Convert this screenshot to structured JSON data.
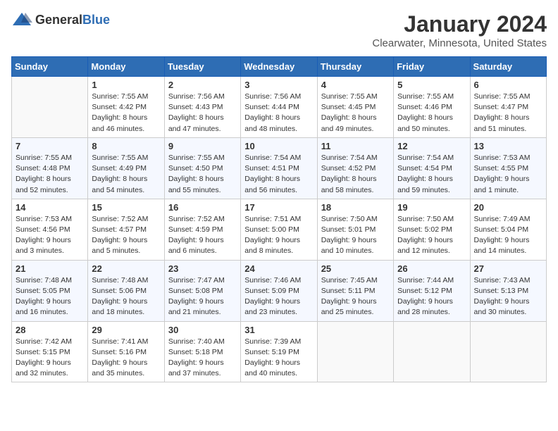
{
  "header": {
    "logo_general": "General",
    "logo_blue": "Blue",
    "month_title": "January 2024",
    "location": "Clearwater, Minnesota, United States"
  },
  "days_of_week": [
    "Sunday",
    "Monday",
    "Tuesday",
    "Wednesday",
    "Thursday",
    "Friday",
    "Saturday"
  ],
  "weeks": [
    [
      {
        "day": "",
        "sunrise": "",
        "sunset": "",
        "daylight": ""
      },
      {
        "day": "1",
        "sunrise": "Sunrise: 7:55 AM",
        "sunset": "Sunset: 4:42 PM",
        "daylight": "Daylight: 8 hours and 46 minutes."
      },
      {
        "day": "2",
        "sunrise": "Sunrise: 7:56 AM",
        "sunset": "Sunset: 4:43 PM",
        "daylight": "Daylight: 8 hours and 47 minutes."
      },
      {
        "day": "3",
        "sunrise": "Sunrise: 7:56 AM",
        "sunset": "Sunset: 4:44 PM",
        "daylight": "Daylight: 8 hours and 48 minutes."
      },
      {
        "day": "4",
        "sunrise": "Sunrise: 7:55 AM",
        "sunset": "Sunset: 4:45 PM",
        "daylight": "Daylight: 8 hours and 49 minutes."
      },
      {
        "day": "5",
        "sunrise": "Sunrise: 7:55 AM",
        "sunset": "Sunset: 4:46 PM",
        "daylight": "Daylight: 8 hours and 50 minutes."
      },
      {
        "day": "6",
        "sunrise": "Sunrise: 7:55 AM",
        "sunset": "Sunset: 4:47 PM",
        "daylight": "Daylight: 8 hours and 51 minutes."
      }
    ],
    [
      {
        "day": "7",
        "sunrise": "Sunrise: 7:55 AM",
        "sunset": "Sunset: 4:48 PM",
        "daylight": "Daylight: 8 hours and 52 minutes."
      },
      {
        "day": "8",
        "sunrise": "Sunrise: 7:55 AM",
        "sunset": "Sunset: 4:49 PM",
        "daylight": "Daylight: 8 hours and 54 minutes."
      },
      {
        "day": "9",
        "sunrise": "Sunrise: 7:55 AM",
        "sunset": "Sunset: 4:50 PM",
        "daylight": "Daylight: 8 hours and 55 minutes."
      },
      {
        "day": "10",
        "sunrise": "Sunrise: 7:54 AM",
        "sunset": "Sunset: 4:51 PM",
        "daylight": "Daylight: 8 hours and 56 minutes."
      },
      {
        "day": "11",
        "sunrise": "Sunrise: 7:54 AM",
        "sunset": "Sunset: 4:52 PM",
        "daylight": "Daylight: 8 hours and 58 minutes."
      },
      {
        "day": "12",
        "sunrise": "Sunrise: 7:54 AM",
        "sunset": "Sunset: 4:54 PM",
        "daylight": "Daylight: 8 hours and 59 minutes."
      },
      {
        "day": "13",
        "sunrise": "Sunrise: 7:53 AM",
        "sunset": "Sunset: 4:55 PM",
        "daylight": "Daylight: 9 hours and 1 minute."
      }
    ],
    [
      {
        "day": "14",
        "sunrise": "Sunrise: 7:53 AM",
        "sunset": "Sunset: 4:56 PM",
        "daylight": "Daylight: 9 hours and 3 minutes."
      },
      {
        "day": "15",
        "sunrise": "Sunrise: 7:52 AM",
        "sunset": "Sunset: 4:57 PM",
        "daylight": "Daylight: 9 hours and 5 minutes."
      },
      {
        "day": "16",
        "sunrise": "Sunrise: 7:52 AM",
        "sunset": "Sunset: 4:59 PM",
        "daylight": "Daylight: 9 hours and 6 minutes."
      },
      {
        "day": "17",
        "sunrise": "Sunrise: 7:51 AM",
        "sunset": "Sunset: 5:00 PM",
        "daylight": "Daylight: 9 hours and 8 minutes."
      },
      {
        "day": "18",
        "sunrise": "Sunrise: 7:50 AM",
        "sunset": "Sunset: 5:01 PM",
        "daylight": "Daylight: 9 hours and 10 minutes."
      },
      {
        "day": "19",
        "sunrise": "Sunrise: 7:50 AM",
        "sunset": "Sunset: 5:02 PM",
        "daylight": "Daylight: 9 hours and 12 minutes."
      },
      {
        "day": "20",
        "sunrise": "Sunrise: 7:49 AM",
        "sunset": "Sunset: 5:04 PM",
        "daylight": "Daylight: 9 hours and 14 minutes."
      }
    ],
    [
      {
        "day": "21",
        "sunrise": "Sunrise: 7:48 AM",
        "sunset": "Sunset: 5:05 PM",
        "daylight": "Daylight: 9 hours and 16 minutes."
      },
      {
        "day": "22",
        "sunrise": "Sunrise: 7:48 AM",
        "sunset": "Sunset: 5:06 PM",
        "daylight": "Daylight: 9 hours and 18 minutes."
      },
      {
        "day": "23",
        "sunrise": "Sunrise: 7:47 AM",
        "sunset": "Sunset: 5:08 PM",
        "daylight": "Daylight: 9 hours and 21 minutes."
      },
      {
        "day": "24",
        "sunrise": "Sunrise: 7:46 AM",
        "sunset": "Sunset: 5:09 PM",
        "daylight": "Daylight: 9 hours and 23 minutes."
      },
      {
        "day": "25",
        "sunrise": "Sunrise: 7:45 AM",
        "sunset": "Sunset: 5:11 PM",
        "daylight": "Daylight: 9 hours and 25 minutes."
      },
      {
        "day": "26",
        "sunrise": "Sunrise: 7:44 AM",
        "sunset": "Sunset: 5:12 PM",
        "daylight": "Daylight: 9 hours and 28 minutes."
      },
      {
        "day": "27",
        "sunrise": "Sunrise: 7:43 AM",
        "sunset": "Sunset: 5:13 PM",
        "daylight": "Daylight: 9 hours and 30 minutes."
      }
    ],
    [
      {
        "day": "28",
        "sunrise": "Sunrise: 7:42 AM",
        "sunset": "Sunset: 5:15 PM",
        "daylight": "Daylight: 9 hours and 32 minutes."
      },
      {
        "day": "29",
        "sunrise": "Sunrise: 7:41 AM",
        "sunset": "Sunset: 5:16 PM",
        "daylight": "Daylight: 9 hours and 35 minutes."
      },
      {
        "day": "30",
        "sunrise": "Sunrise: 7:40 AM",
        "sunset": "Sunset: 5:18 PM",
        "daylight": "Daylight: 9 hours and 37 minutes."
      },
      {
        "day": "31",
        "sunrise": "Sunrise: 7:39 AM",
        "sunset": "Sunset: 5:19 PM",
        "daylight": "Daylight: 9 hours and 40 minutes."
      },
      {
        "day": "",
        "sunrise": "",
        "sunset": "",
        "daylight": ""
      },
      {
        "day": "",
        "sunrise": "",
        "sunset": "",
        "daylight": ""
      },
      {
        "day": "",
        "sunrise": "",
        "sunset": "",
        "daylight": ""
      }
    ]
  ]
}
